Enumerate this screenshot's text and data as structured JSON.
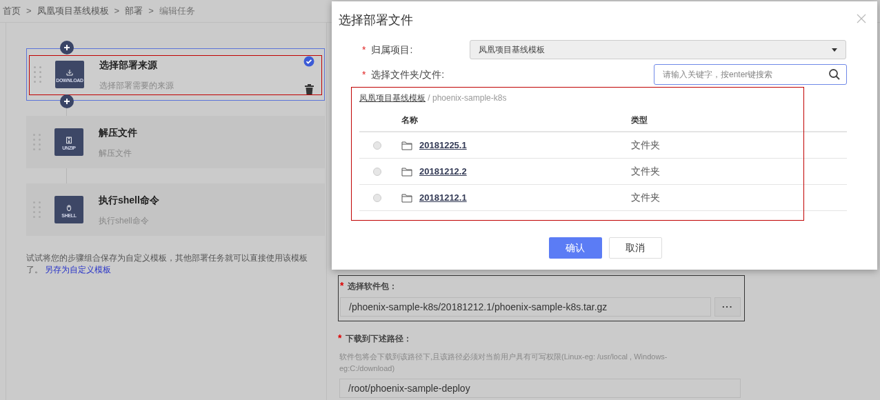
{
  "breadcrumb": [
    "首页",
    "凤凰项目基线模板",
    "部署",
    "编辑任务"
  ],
  "breadcrumb_separator": ">",
  "required_mark": "*",
  "steps": [
    {
      "kind": "download",
      "icon_label": "DOWNLOAD",
      "title": "选择部署来源",
      "subtitle": "选择部署需要的来源",
      "selected": true
    },
    {
      "kind": "unzip",
      "icon_label": "UNZIP",
      "title": "解压文件",
      "subtitle": "解压文件",
      "selected": false
    },
    {
      "kind": "shell",
      "icon_label": "SHELL",
      "title": "执行shell命令",
      "subtitle": "执行shell命令",
      "selected": false
    }
  ],
  "tip": {
    "text": "试试将您的步骤组合保存为自定义模板，其他部署任务就可以直接使用该模板了。",
    "link": "另存为自定义模板"
  },
  "form": {
    "package_label": "选择软件包：",
    "package_value": "/phoenix-sample-k8s/20181212.1/phoenix-sample-k8s.tar.gz",
    "browse_button": "···",
    "path_label": "下载到下述路径：",
    "path_help": "软件包将会下载到该路径下,且该路径必须对当前用户具有可写权限(Linux-eg: /usr/local , Windows-eg:C:/download)",
    "path_value": "/root/phoenix-sample-deploy"
  },
  "dialog": {
    "title": "选择部署文件",
    "project_label": "归属项目:",
    "project_value": "凤凰项目基线模板",
    "file_label": "选择文件夹/文件:",
    "search_placeholder": "请输入关键字，按enter键搜索",
    "path_root": "凤凰项目基线模板",
    "path_rest": " / phoenix-sample-k8s",
    "columns": [
      "名称",
      "类型"
    ],
    "rows": [
      {
        "name": "20181225.1",
        "type": "文件夹",
        "selected": false
      },
      {
        "name": "20181212.2",
        "type": "文件夹",
        "selected": false
      },
      {
        "name": "20181212.1",
        "type": "文件夹",
        "selected": false
      }
    ],
    "buttons": [
      "确认",
      "取消"
    ]
  }
}
